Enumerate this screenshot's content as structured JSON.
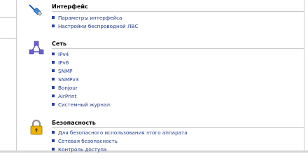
{
  "sections": [
    {
      "title": "Интерфейс",
      "icon": "network-cable-icon",
      "items": [
        "Параметры интерфейса",
        "Настройки беспроводной ЛВС"
      ]
    },
    {
      "title": "Сеть",
      "icon": "network-topology-icon",
      "items": [
        "IPv4",
        "IPv6",
        "SNMP",
        "SNMPv3",
        "Bonjour",
        "AirPrint",
        "Системный журнал"
      ]
    },
    {
      "title": "Безопасность",
      "icon": "padlock-icon",
      "items": [
        "Для безопасного использования этого аппарата",
        "Сетевая безопасность",
        "Контроль доступа"
      ]
    }
  ]
}
